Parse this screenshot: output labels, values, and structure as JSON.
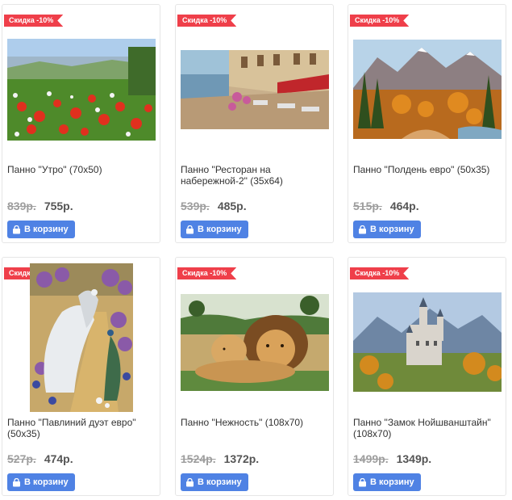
{
  "colors": {
    "discount_badge": "#ef3f4a",
    "cart_button": "#4f82e4"
  },
  "products": [
    {
      "badge": "Скидка -10%",
      "title": "Панно \"Утро\" (70x50)",
      "old_price": "839р.",
      "new_price": "755р.",
      "button_label": "В корзину",
      "button_icon": "shopping-bag-icon"
    },
    {
      "badge": "Скидка -10%",
      "title": "Панно \"Ресторан на набережной-2\" (35x64)",
      "old_price": "539р.",
      "new_price": "485р.",
      "button_label": "В корзину",
      "button_icon": "shopping-bag-icon"
    },
    {
      "badge": "Скидка -10%",
      "title": "Панно \"Полдень евро\" (50x35)",
      "old_price": "515р.",
      "new_price": "464р.",
      "button_label": "В корзину",
      "button_icon": "shopping-bag-icon"
    },
    {
      "badge": "Скидка -10%",
      "title": "Панно \"Павлиний дуэт евро\" (50x35)",
      "old_price": "527р.",
      "new_price": "474р.",
      "button_label": "В корзину",
      "button_icon": "shopping-bag-icon"
    },
    {
      "badge": "Скидка -10%",
      "title": "Панно \"Нежность\" (108x70)",
      "old_price": "1524р.",
      "new_price": "1372р.",
      "button_label": "В корзину",
      "button_icon": "shopping-bag-icon"
    },
    {
      "badge": "Скидка -10%",
      "title": "Панно \"Замок Нойшванштайн\" (108x70)",
      "old_price": "1499р.",
      "new_price": "1349р.",
      "button_label": "В корзину",
      "button_icon": "shopping-bag-icon"
    }
  ]
}
